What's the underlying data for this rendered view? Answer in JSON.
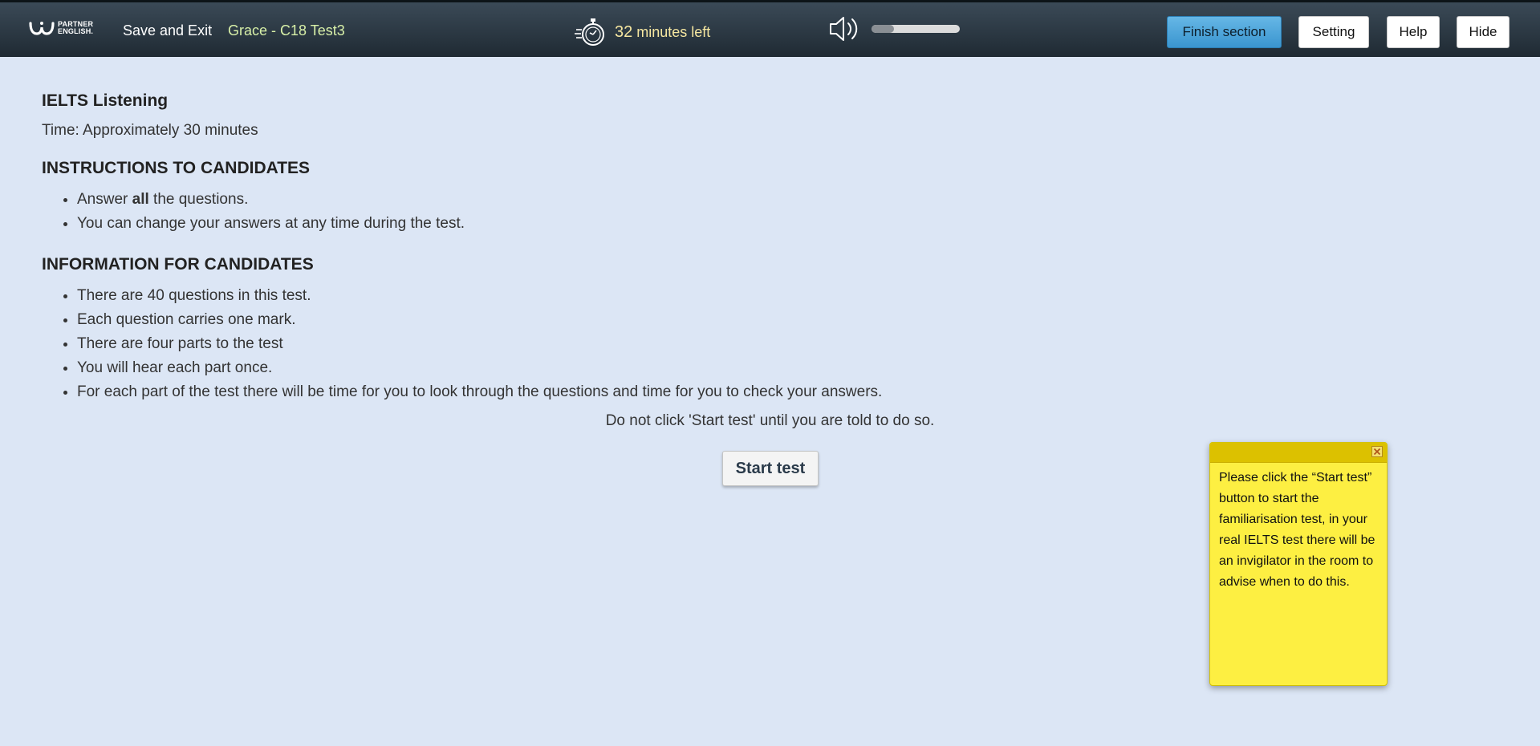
{
  "header": {
    "logo_text_line1": "PARTNER",
    "logo_text_line2": "ENGLISH.",
    "save_exit_label": "Save and Exit",
    "candidate_label": "Grace - C18 Test3",
    "timer_number": "32",
    "timer_suffix": "minutes left",
    "volume_level": 0.25,
    "finish_label": "Finish section",
    "setting_label": "Setting",
    "help_label": "Help",
    "hide_label": "Hide"
  },
  "main": {
    "title": "IELTS Listening",
    "time_text": "Time: Approximately 30 minutes",
    "instructions_heading": "INSTRUCTIONS TO CANDIDATES",
    "instructions": {
      "item1_before": "Answer ",
      "item1_bold": "all",
      "item1_after": " the questions.",
      "item2": "You can change your answers at any time during the test."
    },
    "information_heading": "INFORMATION FOR CANDIDATES",
    "information": [
      "There are 40 questions in this test.",
      "Each question carries one mark.",
      "There are four parts to the test",
      "You will hear each part once.",
      "For each part of the test there will be time for you to look through the questions and time for you to check your answers."
    ],
    "notice": "Do not click 'Start test' until you are told to do so.",
    "start_label": "Start test"
  },
  "sticky_note": {
    "text": "Please click the “Start test” button to start the familiarisation test, in your real IELTS test there will be an invigilator in the room to advise when to do this."
  },
  "colors": {
    "background": "#dce6f5",
    "header_dark": "#1f2a33",
    "finish_button": "#3a95cf",
    "timer_text": "#f5e6a0",
    "candidate_text": "#d8f0a8",
    "note_yellow": "#fdef42"
  },
  "icons": {
    "logo": "partner-english-logo",
    "timer": "stopwatch-icon",
    "volume": "speaker-icon",
    "close": "close-icon"
  }
}
